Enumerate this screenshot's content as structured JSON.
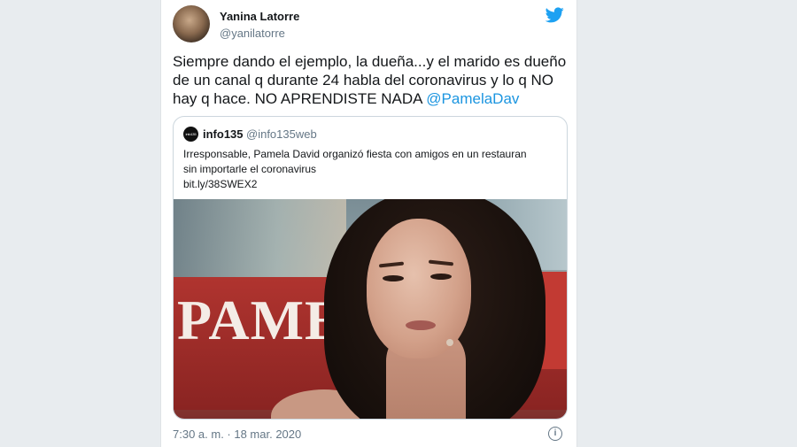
{
  "tweet": {
    "author": {
      "name": "Yanina Latorre",
      "handle": "@yanilatorre"
    },
    "text_lines": [
      "Siempre dando el ejemplo, la dueña...y el marido es dueño",
      "de un canal q durante 24 habla del coronavirus y lo q NO",
      "hay q hace. NO APRENDISTE NADA "
    ],
    "mention": "@PamelaDav",
    "timestamp": "7:30 a. m. · 18 mar. 2020",
    "icons": {
      "brand": "twitter-bird-icon",
      "info": "info-icon"
    },
    "colors": {
      "accent": "#1b95e0",
      "muted": "#657786",
      "text": "#14171a"
    }
  },
  "quoted": {
    "avatar_text": "info135",
    "name": "info135",
    "handle": "@info135web",
    "text_lines": [
      "Irresponsable, Pamela David organizó fiesta con amigos en un restauran",
      "sin importarle el coronavirus",
      "bit.ly/38SWEX2"
    ],
    "image": {
      "overlay_text": "PAMELA"
    }
  }
}
